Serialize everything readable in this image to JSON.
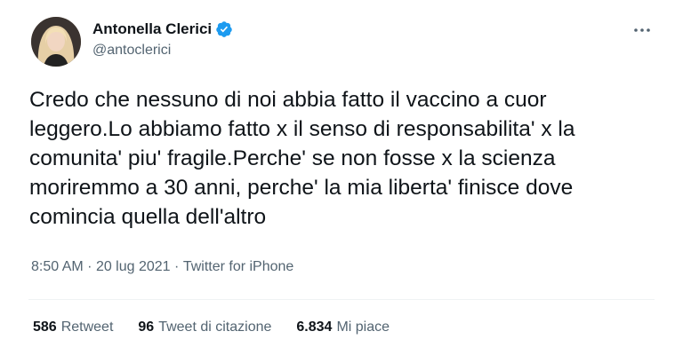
{
  "author": {
    "display_name": "Antonella Clerici",
    "handle": "@antoclerici",
    "verified_color": "#1d9bf0"
  },
  "tweet": {
    "text": "Credo che nessuno di noi abbia fatto il vaccino a cuor\nleggero.Lo abbiamo fatto x il senso di responsabilita' x la\ncomunita' piu' fragile.Perche' se non fosse x la scienza\nmoriremmo a 30 anni, perche' la mia liberta' finisce dove\ncomincia quella dell'altro",
    "time": "8:50 AM",
    "separator1": "·",
    "date": "20 lug 2021",
    "separator2": "·",
    "source": "Twitter for iPhone"
  },
  "stats": {
    "retweets_count": "586",
    "retweets_label": "Retweet",
    "quotes_count": "96",
    "quotes_label": "Tweet di citazione",
    "likes_count": "6.834",
    "likes_label": "Mi piace"
  },
  "icons": {
    "avatar": "avatar",
    "verified": "verified-badge-icon",
    "more": "more-options-icon"
  }
}
